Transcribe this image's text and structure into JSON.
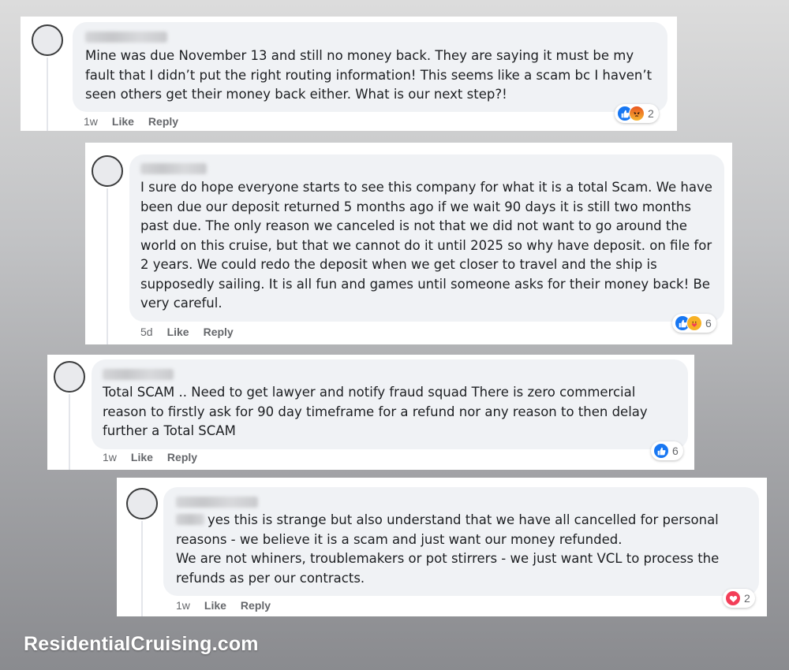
{
  "comments": [
    {
      "text": "Mine was due November 13 and still no money back. They are saying it must be my\nfault that I didn’t put the right routing information! This seems like a scam bc I haven’t\nseen others get their money back either. What is our next step?!",
      "time": "1w",
      "like_label": "Like",
      "reply_label": "Reply",
      "reactions": [
        "like",
        "angry"
      ],
      "reaction_count": "2"
    },
    {
      "text": "I sure do hope everyone starts to see this company for what it is a total Scam. We have\nbeen due our deposit returned 5 months ago if we wait 90 days it is still two months\npast due. The only reason we canceled is not that we did not want to go around the\nworld on this cruise, but that we cannot do it until 2025 so why have deposit. on file for\n2 years. We could redo the deposit when we get closer to travel and the ship is\nsupposedly sailing. It is all fun and games until someone asks for their money back! Be\nvery careful.",
      "time": "5d",
      "like_label": "Like",
      "reply_label": "Reply",
      "reactions": [
        "like",
        "care"
      ],
      "reaction_count": "6"
    },
    {
      "text": "Total SCAM .. Need to get lawyer and notify fraud squad There is zero commercial\nreason to firstly ask for 90 day timeframe for a refund nor any reason to then delay\nfurther a Total SCAM",
      "time": "1w",
      "like_label": "Like",
      "reply_label": "Reply",
      "reactions": [
        "like"
      ],
      "reaction_count": "6"
    },
    {
      "text": "yes this is strange but also understand that we have all cancelled for personal\nreasons - we believe it is a scam and just want our money refunded.\nWe are not whiners, troublemakers or pot stirrers - we just want VCL to process the\nrefunds as per our contracts.",
      "time": "1w",
      "like_label": "Like",
      "reply_label": "Reply",
      "reactions": [
        "love"
      ],
      "reaction_count": "2"
    }
  ],
  "watermark": "ResidentialCruising.com",
  "colors": {
    "bubble": "#f0f2f5",
    "like_blue": "#1877f2",
    "love_red": "#f33e58",
    "meta_gray": "#65676b"
  }
}
